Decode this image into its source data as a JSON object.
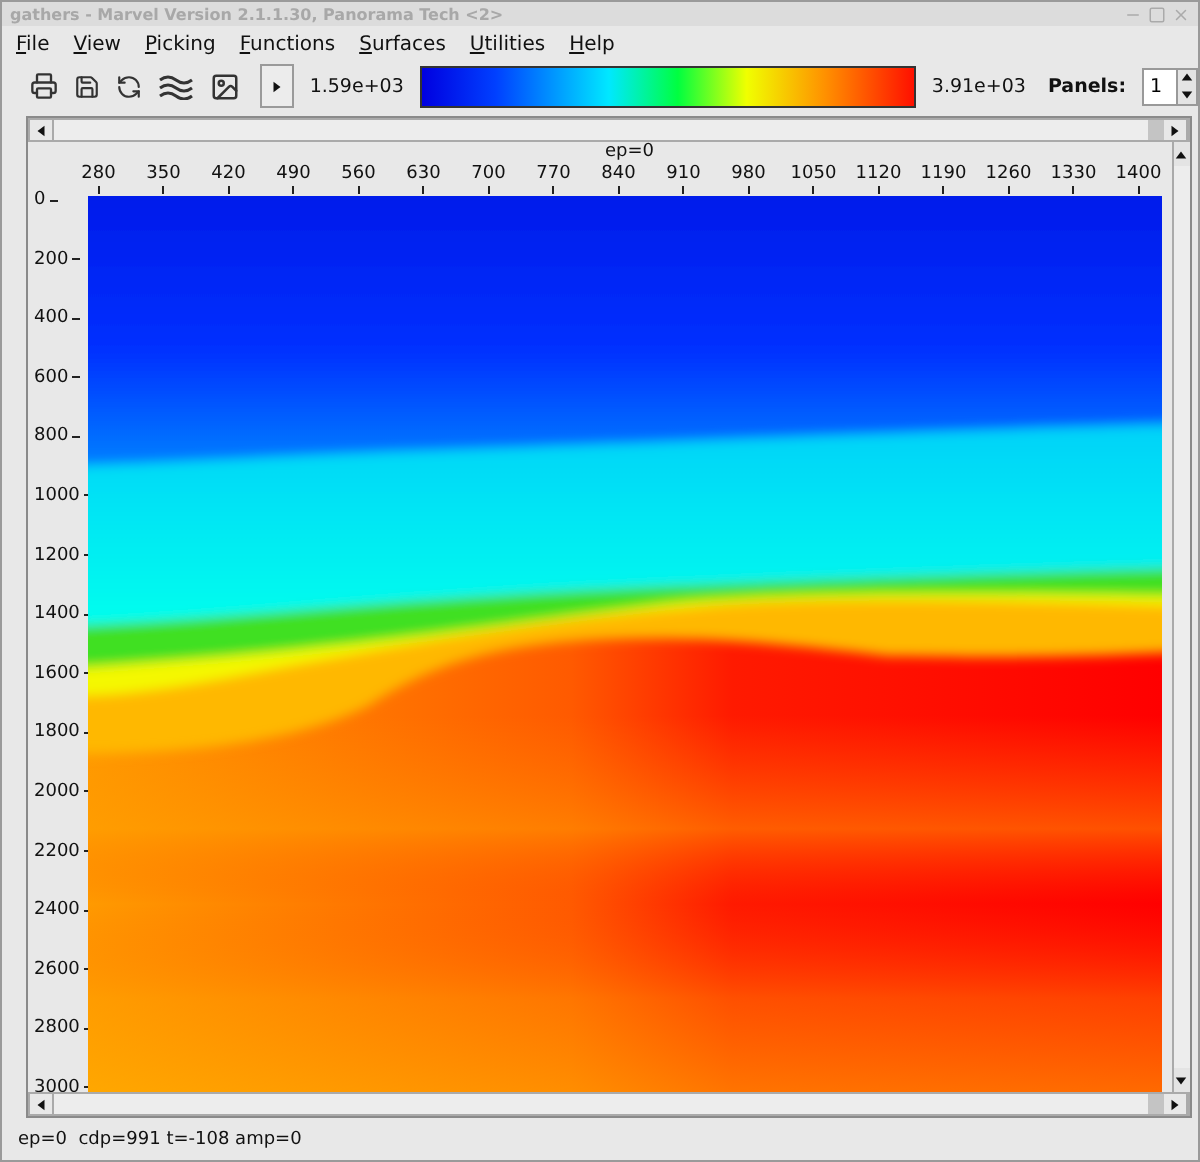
{
  "window": {
    "title": "gathers - Marvel Version 2.1.1.30, Panorama Tech <2>"
  },
  "menu": [
    "File",
    "View",
    "Picking",
    "Functions",
    "Surfaces",
    "Utilities",
    "Help"
  ],
  "colorbar": {
    "min": "1.59e+03",
    "max": "3.91e+03"
  },
  "panels": {
    "label": "Panels:",
    "value": "1"
  },
  "plot": {
    "title": "ep=0",
    "x_ticks": [
      "280",
      "350",
      "420",
      "490",
      "560",
      "630",
      "700",
      "770",
      "840",
      "910",
      "980",
      "1050",
      "1120",
      "1190",
      "1260",
      "1330",
      "1400"
    ],
    "y_ticks": [
      "0",
      "200",
      "400",
      "600",
      "800",
      "1000",
      "1200",
      "1400",
      "1600",
      "1800",
      "2000",
      "2200",
      "2400",
      "2600",
      "2800",
      "3000"
    ]
  },
  "status_bar": "ep=0  cdp=991 t=-108 amp=0"
}
